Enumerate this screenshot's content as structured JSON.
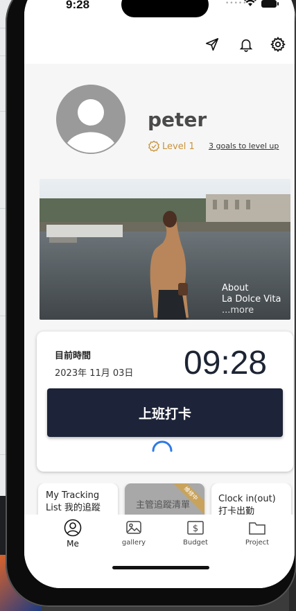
{
  "status": {
    "time": "9:28"
  },
  "profile": {
    "name": "peter",
    "level": "Level 1",
    "goals_link": "3 goals to level up"
  },
  "hero": {
    "about": "About",
    "title": "La Dolce Vita",
    "more": "...more"
  },
  "clock_card": {
    "label": "目前時間",
    "date": "2023年 11月 03日",
    "time": "09:28",
    "button_label": "上班打卡"
  },
  "tiles": [
    {
      "line1": "My Tracking",
      "line2": "List  我的追蹤"
    },
    {
      "label": "主管追蹤清單",
      "ribbon": "維修中"
    },
    {
      "line1": "Clock in(out)",
      "line2": "打卡出勤"
    }
  ],
  "nav": {
    "items": [
      {
        "label": "Me",
        "icon": "person-icon"
      },
      {
        "label": "gallery",
        "icon": "gallery-icon"
      },
      {
        "label": "Budget",
        "icon": "dollar-icon"
      },
      {
        "label": "Project",
        "icon": "folder-icon"
      }
    ]
  },
  "colors": {
    "accent_gold": "#c9933a",
    "button_dark": "#1d2338",
    "clock_text": "#1d2433"
  }
}
